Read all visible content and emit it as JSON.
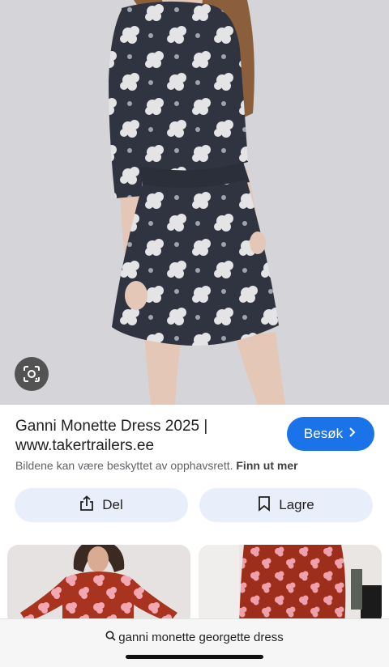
{
  "result": {
    "title": "Ganni Monette Dress 2025 | www.takertrailers.ee",
    "visit_label": "Besøk",
    "copyright_text": "Bildene kan være beskyttet av opphavsrett.",
    "learn_more_label": "Finn ut mer"
  },
  "actions": {
    "share_label": "Del",
    "save_label": "Lagre"
  },
  "search": {
    "query": "ganni monette georgette dress"
  },
  "icons": {
    "lens": "lens-icon",
    "share": "share-icon",
    "save": "bookmark-icon",
    "visit": "chevron-right-icon",
    "search": "search-icon"
  },
  "colors": {
    "accent": "#1a73e8",
    "action_button_bg": "#e8effa",
    "dress": "#2f3440",
    "print": "#e4e4e6"
  }
}
